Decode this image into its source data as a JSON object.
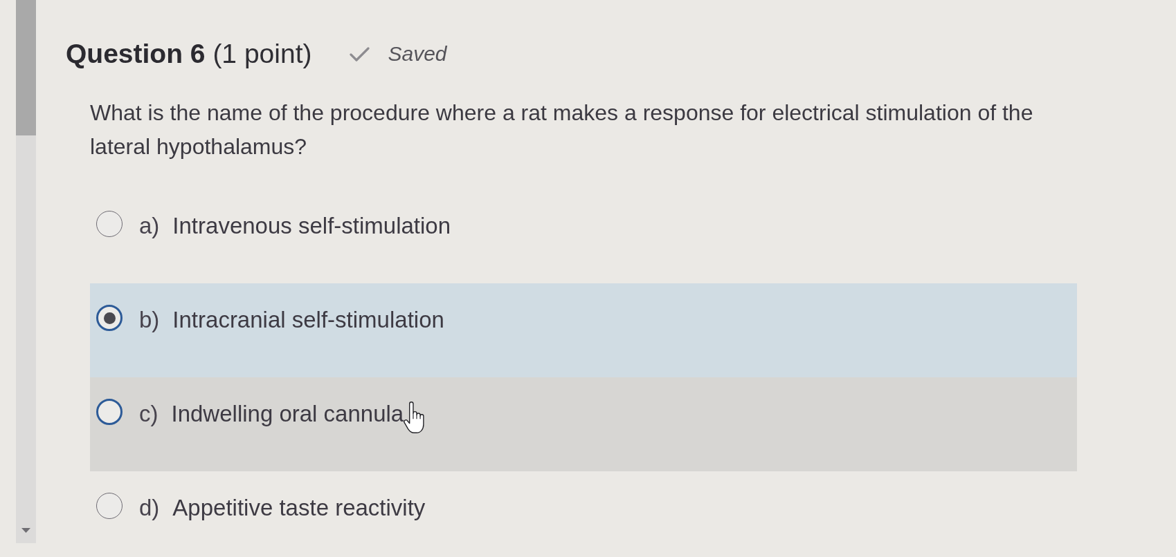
{
  "question": {
    "title": "**Question 6** (1 point)",
    "status": "Saved",
    "text": "What is the name of the procedure where a rat makes a response for electrical stimulation of the lateral hypothalamus?"
  },
  "options": [
    {
      "letter": "a)",
      "label": "Intravenous self-stimulation",
      "selected": false,
      "hovered": false
    },
    {
      "letter": "b)",
      "label": "Intracranial self-stimulation",
      "selected": true,
      "hovered": false
    },
    {
      "letter": "c)",
      "label": "Indwelling oral cannula",
      "selected": false,
      "hovered": true
    },
    {
      "letter": "d)",
      "label": "Appetitive taste reactivity",
      "selected": false,
      "hovered": false
    }
  ]
}
